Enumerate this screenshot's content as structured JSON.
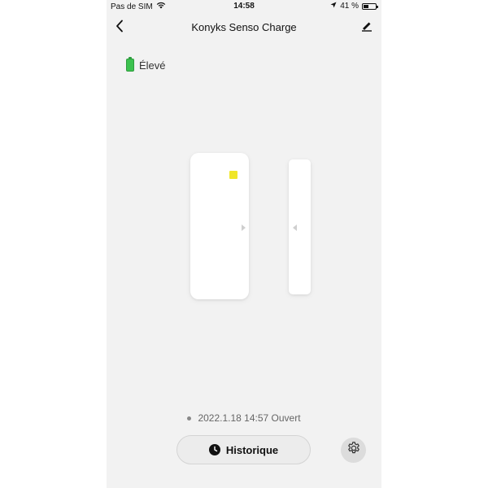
{
  "status_bar": {
    "carrier": "Pas de SIM",
    "time": "14:58",
    "battery_percent": "41 %",
    "battery_fraction": 0.41
  },
  "nav": {
    "title": "Konyks Senso Charge"
  },
  "battery_level": {
    "label": "Élevé",
    "color": "#3cc24f"
  },
  "sensor": {
    "led_color": "#f0e62a"
  },
  "last_event": {
    "text": "2022.1.18 14:57 Ouvert"
  },
  "actions": {
    "history_label": "Historique"
  },
  "icons": {
    "wifi": "wifi-icon",
    "location": "location-arrow-icon",
    "back": "chevron-left-icon",
    "edit": "pencil-icon",
    "clock": "clock-icon",
    "settings": "gear-icon"
  }
}
